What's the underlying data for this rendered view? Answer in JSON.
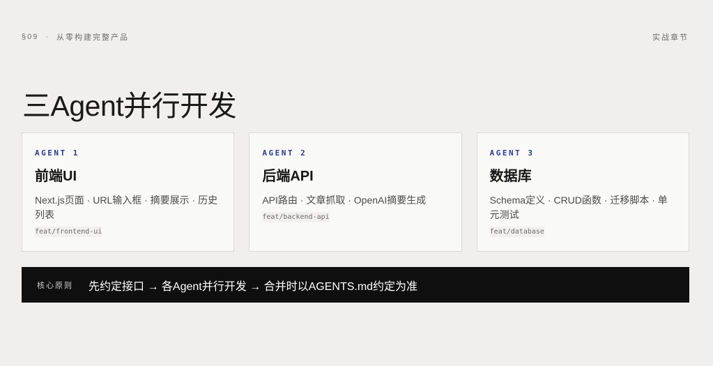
{
  "header": {
    "section": "§09",
    "separator": "·",
    "chapter": "从零构建完整产品",
    "right_label": "实战章节"
  },
  "title": "三Agent并行开发",
  "cards": [
    {
      "tag": "AGENT 1",
      "name": "前端UI",
      "desc": "Next.js页面 · URL输入框 · 摘要展示 · 历史列表",
      "branch": "feat/frontend-ui"
    },
    {
      "tag": "AGENT 2",
      "name": "后端API",
      "desc": "API路由 · 文章抓取 · OpenAI摘要生成",
      "branch": "feat/backend-api"
    },
    {
      "tag": "AGENT 3",
      "name": "数据库",
      "desc": "Schema定义 · CRUD函数 · 迁移脚本 · 单元测试",
      "branch": "feat/database"
    }
  ],
  "principle": {
    "label": "核心原则",
    "text": "先约定接口 → 各Agent并行开发 → 合并时以AGENTS.md约定为准"
  },
  "colors": {
    "background": "#f0efed",
    "accent": "#2a3a8f",
    "banner": "#0f0f0f"
  }
}
